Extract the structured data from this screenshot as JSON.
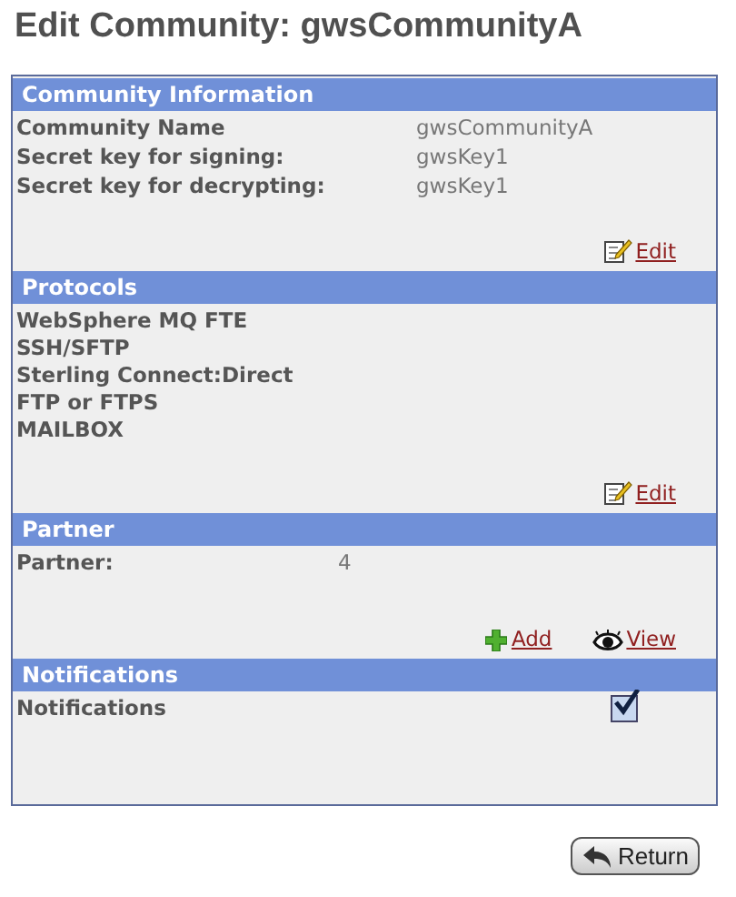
{
  "title": "Edit Community: gwsCommunityA",
  "sections": [
    {
      "kind": "fields",
      "title": "Community Information",
      "rows": [
        {
          "label": "Community Name",
          "value": "gwsCommunityA"
        },
        {
          "label": "Secret key for signing:",
          "value": "gwsKey1"
        },
        {
          "label": "Secret key for decrypting:",
          "value": "gwsKey1"
        }
      ],
      "actions": [
        {
          "kind": "edit",
          "label": "Edit"
        }
      ]
    },
    {
      "kind": "list",
      "title": "Protocols",
      "items": [
        "WebSphere MQ FTE",
        "SSH/SFTP",
        "Sterling Connect:Direct",
        "FTP or FTPS",
        "MAILBOX"
      ],
      "actions": [
        {
          "kind": "edit",
          "label": "Edit"
        }
      ]
    },
    {
      "kind": "fields",
      "title": "Partner",
      "rows": [
        {
          "label": "Partner:",
          "value": "4"
        }
      ],
      "actions": [
        {
          "kind": "add",
          "label": "Add"
        },
        {
          "kind": "view",
          "label": "View"
        }
      ]
    },
    {
      "kind": "check",
      "title": "Notifications",
      "label": "Notifications",
      "checked": true
    }
  ],
  "return_button": "Return"
}
